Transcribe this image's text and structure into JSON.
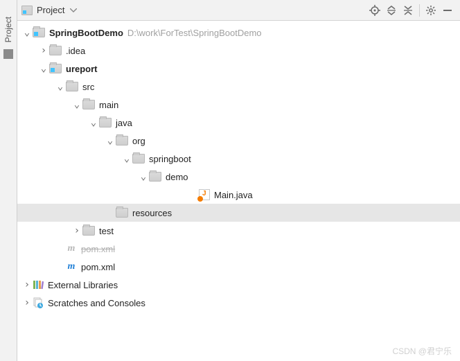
{
  "toolbar": {
    "title": "Project",
    "sideLabel": "Project"
  },
  "project": {
    "name": "SpringBootDemo",
    "path": "D:\\work\\ForTest\\SpringBootDemo"
  },
  "tree": {
    "idea": ".idea",
    "ureport": "ureport",
    "src": "src",
    "main": "main",
    "java": "java",
    "org": "org",
    "springboot": "springboot",
    "demo": "demo",
    "mainJava": "Main.java",
    "resources": "resources",
    "test": "test",
    "pomDim": "pom.xml",
    "pom": "pom.xml",
    "extLib": "External Libraries",
    "scratch": "Scratches and Consoles"
  },
  "watermark": "CSDN @君宁乐"
}
